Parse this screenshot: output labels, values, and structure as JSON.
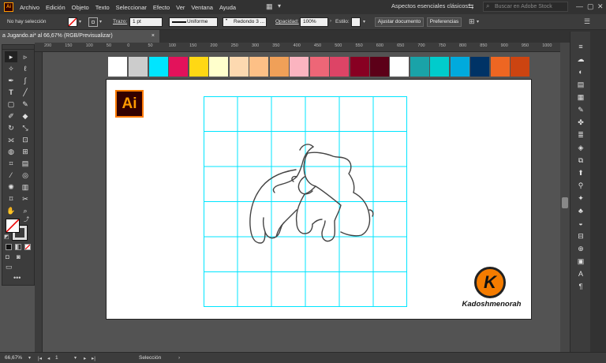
{
  "menubar": {
    "items": [
      "Archivo",
      "Edición",
      "Objeto",
      "Texto",
      "Seleccionar",
      "Efecto",
      "Ver",
      "Ventana",
      "Ayuda"
    ],
    "app_logo": "Ai",
    "workspace": "Aspectos esenciales clásicos",
    "search_placeholder": "Buscar en Adobe Stock"
  },
  "controlbar": {
    "selection_status": "No hay selección",
    "stroke_label": "Trazo:",
    "stroke_weight": "1 pt",
    "stroke_profile": "Uniforme",
    "brush": "Redondo 3 ...",
    "opacity_label": "Opacidad:",
    "opacity_value": "100%",
    "style_label": "Estilo:",
    "adjust_doc_button": "Ajustar documento",
    "preferences_button": "Preferencias"
  },
  "document": {
    "tab_title": "a Jugando.ai* al 66,67% (RGB/Previsualizar)",
    "close_glyph": "×"
  },
  "ruler": {
    "top_ticks": [
      "200",
      "150",
      "100",
      "50",
      "0",
      "50",
      "100",
      "150",
      "200",
      "250",
      "300",
      "350",
      "400",
      "450",
      "500",
      "550",
      "600",
      "650",
      "700",
      "750",
      "800",
      "850",
      "900",
      "950",
      "1000",
      "1050"
    ]
  },
  "swatches": {
    "colors": [
      "#ffffff",
      "#cccccc",
      "#00e5ff",
      "#e3125b",
      "#ffd814",
      "#ffffcc",
      "#fdd9b0",
      "#fdc086",
      "#f0a058",
      "#fbb4c0",
      "#ee6677",
      "#dd4466",
      "#880022",
      "#5c0018",
      "#ffffff",
      "#1aa3a8",
      "#00cccc",
      "#00aadd",
      "#003366",
      "#ee6622",
      "#cc4411"
    ]
  },
  "canvas": {
    "grid_color": "#00e5ff",
    "stroke_color": "#444444",
    "ai_badge": "Ai",
    "logo_letter": "K",
    "logo_name": "Kadoshmenorah"
  },
  "statusbar": {
    "zoom": "66,67%",
    "artboard_num": "1",
    "mode": "Selección"
  },
  "colors": {
    "accent": "#ff7c00",
    "ui_dark": "#323232",
    "ui_panel": "#3c3c3c",
    "canvas_bg": "#535353"
  }
}
